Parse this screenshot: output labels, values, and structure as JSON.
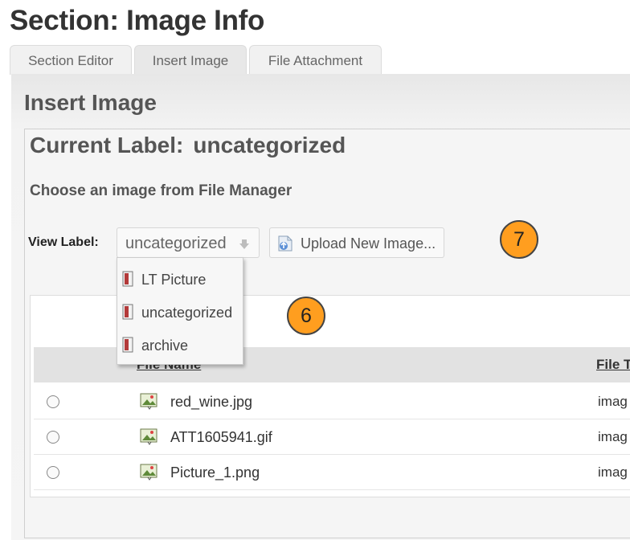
{
  "page": {
    "title": "Section: Image Info"
  },
  "tabs": [
    {
      "label": "Section Editor"
    },
    {
      "label": "Insert Image",
      "active": true
    },
    {
      "label": "File Attachment"
    }
  ],
  "panel": {
    "title": "Insert Image",
    "current_label_prefix": "Current Label:",
    "current_label_value": "uncategorized",
    "choose_text": "Choose an image from File Manager",
    "view_label": "View Label:",
    "selected_label": "uncategorized",
    "upload_button": "Upload New Image..."
  },
  "dropdown_options": [
    "LT Picture",
    "uncategorized",
    "archive"
  ],
  "table": {
    "headers": {
      "file_name": "File Name",
      "file_type": "File T"
    },
    "rows": [
      {
        "name": "red_wine.jpg",
        "type": "imag"
      },
      {
        "name": "ATT1605941.gif",
        "type": "imag"
      },
      {
        "name": "Picture_1.png",
        "type": "imag"
      }
    ]
  },
  "callouts": {
    "six": "6",
    "seven": "7"
  },
  "colors": {
    "callout": "#ff9e1f",
    "header_row": "#e2e2e2",
    "panel_bg": "#f5f5f5"
  },
  "icons": {
    "upload": "upload-icon",
    "label": "label-tag-icon",
    "image_file": "image-file-icon",
    "dropdown_arrow": "chevron-down-icon"
  }
}
